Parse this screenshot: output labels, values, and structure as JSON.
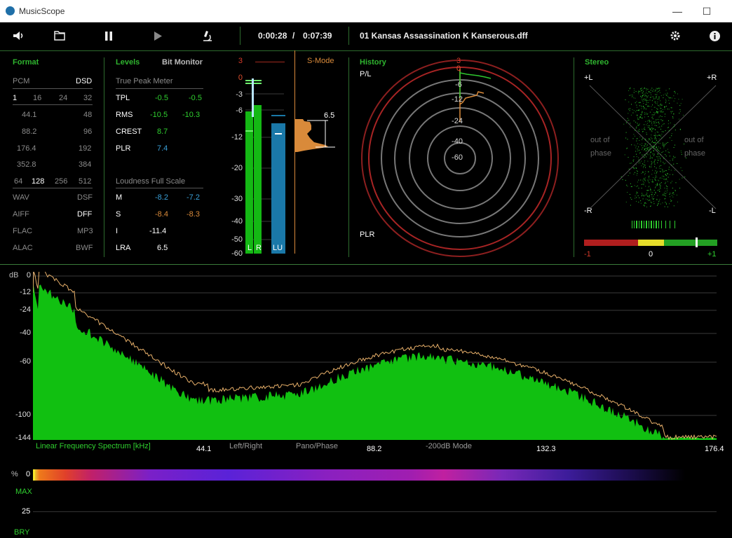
{
  "window": {
    "title": "MusicScope",
    "minimize": "—",
    "maximize": "☐"
  },
  "toolbar": {
    "time_elapsed": "0:00:28",
    "time_sep": "/",
    "time_total": "0:07:39",
    "track_title": "01 Kansas Assassination K Kanserous.dff"
  },
  "format": {
    "title": "Format",
    "pcm": "PCM",
    "dsd": "DSD",
    "bits": [
      "1",
      "16",
      "24",
      "32"
    ],
    "rates": [
      [
        "44.1",
        "48"
      ],
      [
        "88.2",
        "96"
      ],
      [
        "176.4",
        "192"
      ],
      [
        "352.8",
        "384"
      ]
    ],
    "dsd_rates": [
      "64",
      "128",
      "256",
      "512"
    ],
    "containers": [
      [
        "WAV",
        "DSF"
      ],
      [
        "AIFF",
        "DFF"
      ],
      [
        "FLAC",
        "MP3"
      ],
      [
        "ALAC",
        "BWF"
      ]
    ]
  },
  "levels": {
    "title": "Levels",
    "bit_monitor": "Bit Monitor",
    "true_peak_header": "True Peak Meter",
    "rows": [
      {
        "label": "TPL",
        "l": "-0.5",
        "r": "-0.5"
      },
      {
        "label": "RMS",
        "l": "-10.5",
        "r": "-10.3"
      },
      {
        "label": "CREST",
        "l": "8.7",
        "r": ""
      },
      {
        "label": "PLR",
        "l": "7.4",
        "r": ""
      }
    ],
    "loudness_header": "Loudness Full Scale",
    "loud_rows": [
      {
        "label": "M",
        "l": "-8.2",
        "r": "-7.2"
      },
      {
        "label": "S",
        "l": "-8.4",
        "r": "-8.3"
      },
      {
        "label": "I",
        "l": "-11.4",
        "r": ""
      },
      {
        "label": "LRA",
        "l": "6.5",
        "r": ""
      }
    ]
  },
  "meter": {
    "scale": [
      "3",
      "0",
      "-3",
      "-6",
      "-12",
      "-20",
      "-30",
      "-40",
      "-50",
      "-60"
    ],
    "smode": "S-Mode",
    "hist_value": "6.5",
    "labels": [
      "L",
      "R",
      "LU"
    ]
  },
  "history": {
    "title": "History",
    "pl": "P/L",
    "plr": "PLR",
    "rings": [
      "3",
      "0",
      "-6",
      "-12",
      "-24",
      "-40",
      "-60"
    ]
  },
  "stereo": {
    "title": "Stereo",
    "plus_l": "+L",
    "plus_r": "+R",
    "minus_r": "-R",
    "minus_l": "-L",
    "oop_left": [
      "out of",
      "phase"
    ],
    "oop_right": [
      "out of",
      "phase"
    ],
    "corr_labels": [
      "-1",
      "0",
      "+1"
    ]
  },
  "spectrum": {
    "db_label": "dB",
    "y_ticks": [
      "0",
      "-12",
      "-24",
      "-40",
      "-60",
      "-100",
      "-144"
    ],
    "x_ticks": [
      "44.1",
      "88.2",
      "132.3",
      "176.4"
    ],
    "caption": "Linear Frequency Spectrum [kHz]",
    "modes": [
      "Left/Right",
      "Pano/Phase",
      "-200dB Mode"
    ],
    "colors": {
      "fill": "#11c011",
      "trace": "#e8b06a"
    }
  },
  "bottom": {
    "pct": "%",
    "zero": "0",
    "max": "MAX",
    "twentyfive": "25",
    "bry": "BRY"
  }
}
